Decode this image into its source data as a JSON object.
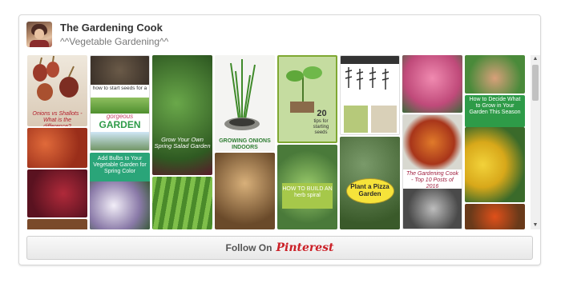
{
  "profile": {
    "name": "The Gardening Cook",
    "board": "^^Vegetable Gardening^^"
  },
  "pins": {
    "p1_caption": "Onions vs Shallots - What is the difference?",
    "p5_line1": "how to start seeds for a",
    "p5_line2": "gorgeous",
    "p5_line3": "GARDEN",
    "p6_caption": "Add Bulbs to Your Vegetable Garden for Spring Color",
    "p8_caption": "Grow Your Own Spring Salad Garden",
    "p10_caption": "GROWING ONIONS INDOORS",
    "p12_number": "20",
    "p12_caption": "tips for starting seeds",
    "p13_caption": "HOW TO BUILD AN herb spiral",
    "p16_caption": "Plant a Pizza Garden",
    "p18_caption": "The Gardening Cook - Top 10 Posts of 2016",
    "p20_caption": "How to Decide What to Grow in Your Garden This Season"
  },
  "follow": {
    "label": "Follow On",
    "brand": "Pinterest"
  },
  "colors": {
    "pinterest_red": "#cb2027",
    "garden_green": "#2e9b48",
    "teal": "#2aa579"
  }
}
